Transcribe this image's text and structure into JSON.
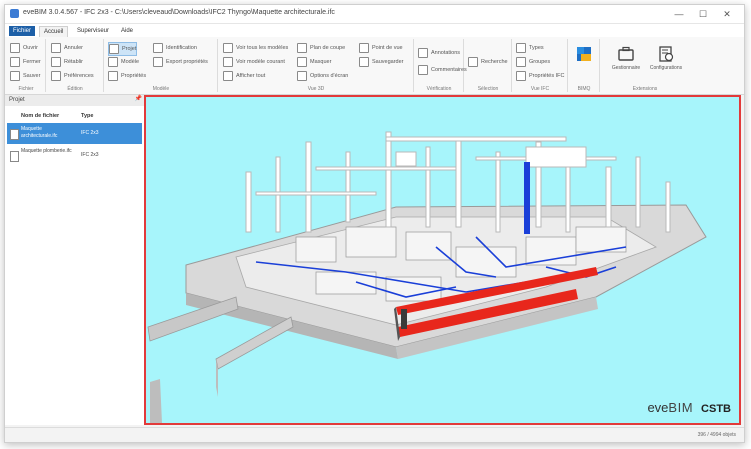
{
  "window": {
    "title": "eveBIM 3.0.4.567 - IFC 2x3 - C:\\Users\\cleveaud\\Downloads\\IFC2 Thyngo\\Maquette architecturale.ifc",
    "minimize": "—",
    "maximize": "☐",
    "close": "✕"
  },
  "menu": {
    "tabs": [
      "Fichier",
      "Accueil",
      "Superviseur",
      "Aide"
    ]
  },
  "ribbon": {
    "groups": [
      {
        "label": "Fichier",
        "buttons": [
          "Ouvrir",
          "Fermer",
          "Sauver"
        ]
      },
      {
        "label": "Édition",
        "buttons": [
          "Annuler",
          "Rétablir",
          "Préférences"
        ]
      },
      {
        "label": "Modèle",
        "buttons": [
          "Projet",
          "Modèle",
          "Propriétés",
          "Identification",
          "Export propriétés"
        ]
      },
      {
        "label": "Vue 3D",
        "buttons": [
          "Voir tous les modèles",
          "Voir modèle courant",
          "Afficher tout",
          "Plan de coupe",
          "Masquer",
          "Options d'écran",
          "Point de vue",
          "Sauvegarder"
        ]
      },
      {
        "label": "Vérification",
        "buttons": [
          "Annotations",
          "Commentaires"
        ]
      },
      {
        "label": "Sélection",
        "buttons": [
          "Recherche"
        ]
      },
      {
        "label": "Vue IFC",
        "buttons": [
          "Types",
          "Groupes",
          "Propriétés IFC"
        ]
      },
      {
        "label": "BIMQ",
        "buttons": [
          "BIMQ"
        ]
      },
      {
        "label": "Extensions",
        "buttons": [
          "Gestionnaire",
          "Configurations"
        ]
      }
    ]
  },
  "project_panel": {
    "title": "Projet",
    "pin": "📌",
    "col_name": "Nom de fichier",
    "col_type": "Type",
    "files": [
      {
        "name": "Maquette architecturale.ifc",
        "type": "IFC 2x3",
        "selected": true
      },
      {
        "name": "Maquette plomberie.ifc",
        "type": "IFC 2x3",
        "selected": false
      }
    ]
  },
  "viewport": {
    "brand_eve": "eve",
    "brand_bim": "BIM",
    "brand_cstb": "CSTB",
    "background": "#a7f5fb"
  },
  "statusbar": {
    "text": "396 / 4994 objets"
  },
  "colors": {
    "accent": "#1d5fa7",
    "selection": "#3d8fd9",
    "viewport_border": "#e23a3a",
    "pipe": "#1a3fd8",
    "wall_highlight": "#e8271c"
  }
}
